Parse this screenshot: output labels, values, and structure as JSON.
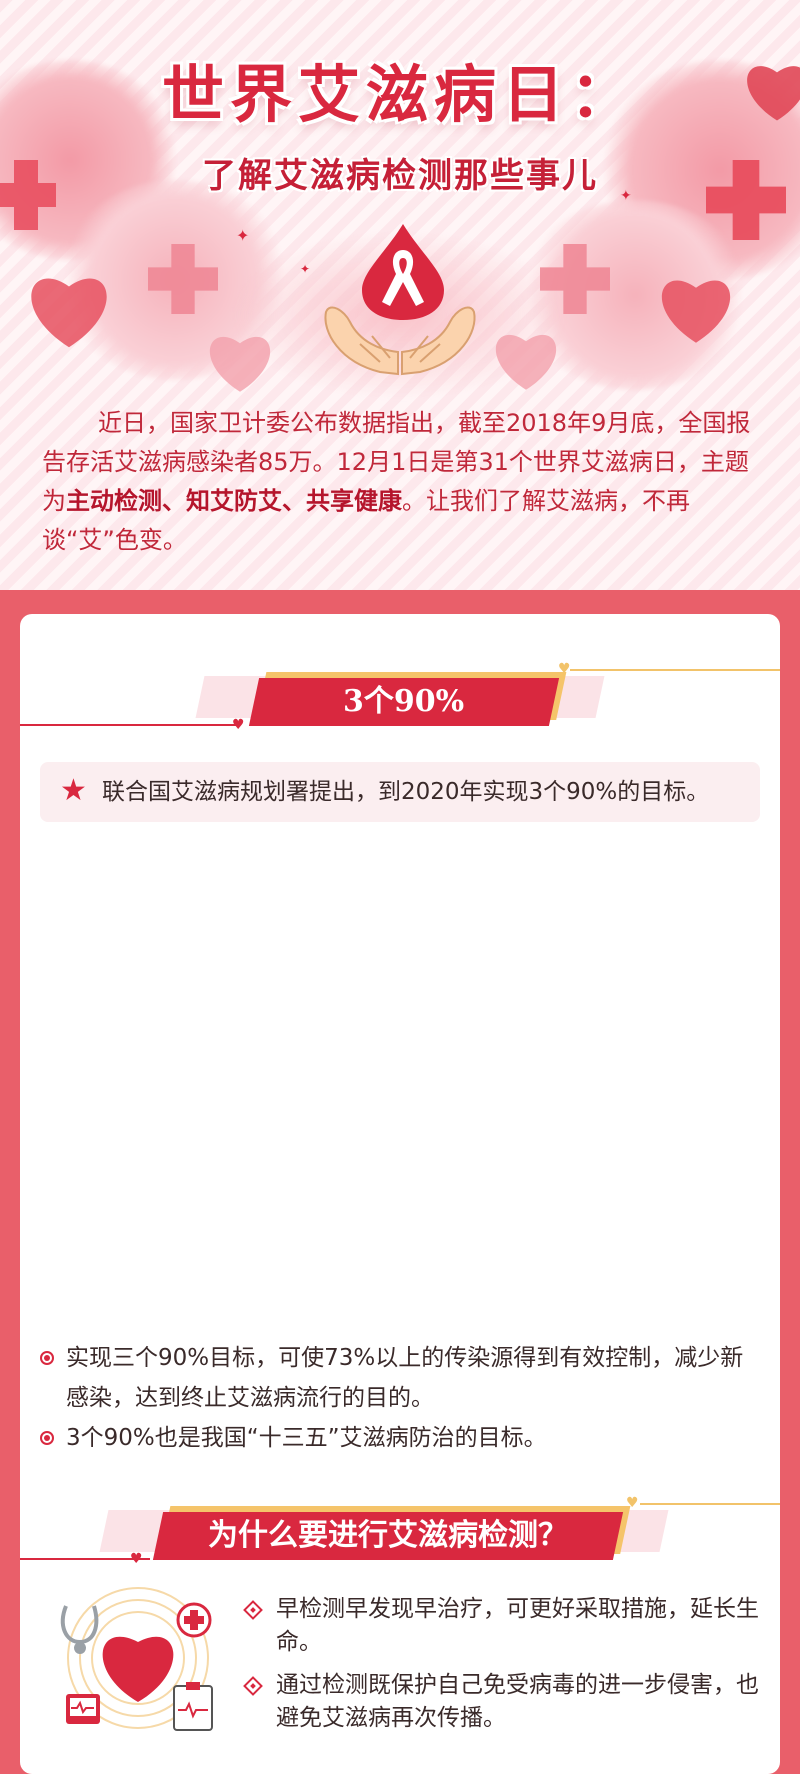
{
  "header": {
    "title": "世界艾滋病日：",
    "subtitle": "了解艾滋病检测那些事儿"
  },
  "intro": {
    "part1": "近日，国家卫计委公布数据指出，截至2018年9月底，全国报告存活艾滋病感染者85万。12月1日是第31个世界艾滋病日，主题为",
    "highlight": "主动检测、知艾防艾、共享健康",
    "part2": "。让我们了解艾滋病，不再谈“艾”色变。"
  },
  "section1": {
    "heading": "3个90%",
    "note": "联合国艾滋病规划署提出，到2020年实现3个90%的目标。",
    "bullets": [
      "实现三个90%目标，可使73%以上的传染源得到有效控制，减少新感染，达到终止艾滋病流行的目的。",
      "3个90%也是我国“十三五”艾滋病防治的目标。"
    ]
  },
  "section2": {
    "heading": "为什么要进行艾滋病检测？",
    "reasons": [
      "早检测早发现早治疗，可更好采取措施，延长生命。",
      "通过检测既保护自己免受病毒的进一步侵害，也避免艾滋病再次传播。"
    ]
  },
  "icons": [
    "aids-ribbon-icon",
    "hands-icon",
    "heart-icon",
    "medical-cross-icon",
    "stethoscope-icon",
    "heart-monitor-icon",
    "medical-chart-icon",
    "star-icon"
  ],
  "colors": {
    "accent": "#d9283f",
    "card_border": "#e95f6a",
    "gold": "#f2c36a",
    "note_bg": "#fbeef0"
  }
}
